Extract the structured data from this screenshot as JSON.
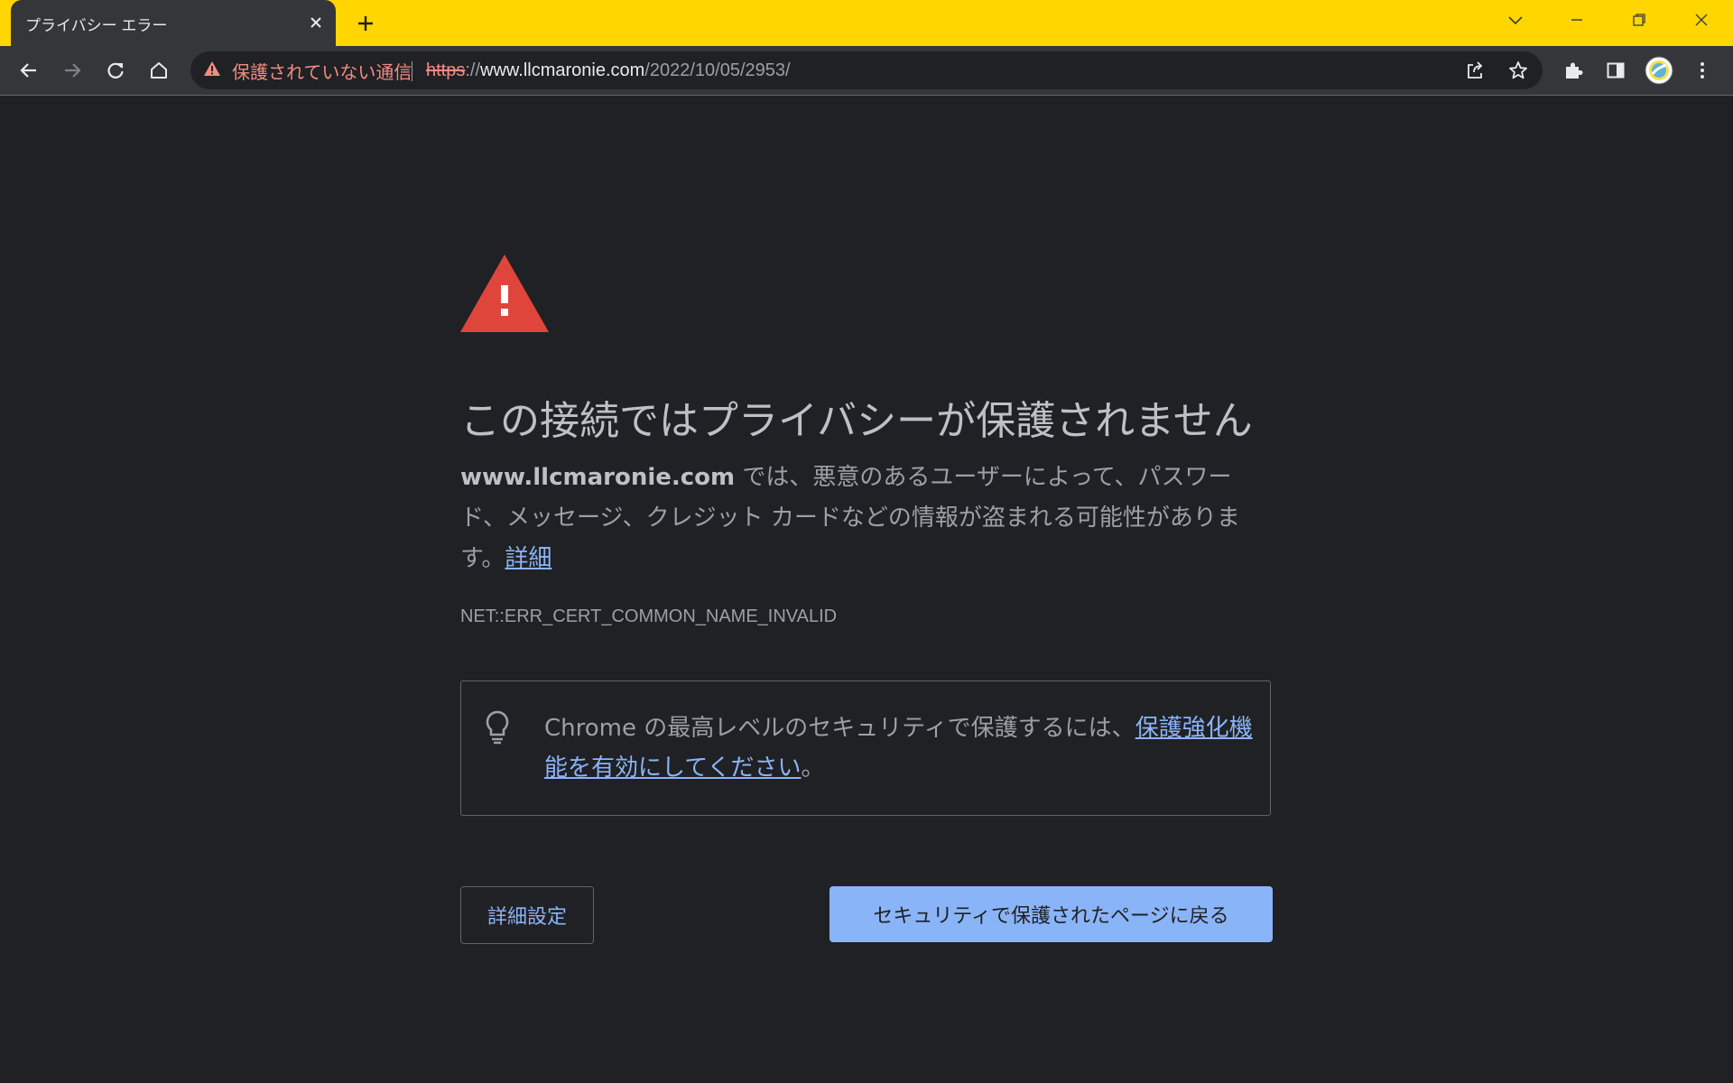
{
  "tab": {
    "title": "プライバシー エラー"
  },
  "colors": {
    "titlebar": "#ffd600",
    "link": "#8ab4f8",
    "warning_red": "#ea4335",
    "insecure_text": "#f28b82"
  },
  "omnibox": {
    "security_label": "保護されていない通信",
    "url_scheme": "https",
    "url_sep": "://",
    "url_host": "www.llcmaronie.com",
    "url_path": "/2022/10/05/2953/"
  },
  "content": {
    "heading": "この接続ではプライバシーが保護されません",
    "site": "www.llcmaronie.com",
    "explanation": " では、悪意のあるユーザーによって、パスワード、メッセージ、クレジット カードなどの情報が盗まれる可能性があります。",
    "details_link": "詳細",
    "error_code": "NET::ERR_CERT_COMMON_NAME_INVALID",
    "tip_text": "Chrome の最高レベルのセキュリティで保護するには、",
    "tip_link": "保護強化機能を有効にしてください",
    "tip_end": "。",
    "advanced_button": "詳細設定",
    "back_button": "セキュリティで保護されたページに戻る"
  },
  "icons": [
    "close-icon",
    "plus-icon",
    "chevron-down-icon",
    "minimize-icon",
    "restore-icon",
    "window-close-icon",
    "back-arrow-icon",
    "forward-arrow-icon",
    "reload-icon",
    "home-icon",
    "warning-icon",
    "share-icon",
    "star-icon",
    "puzzle-icon",
    "side-panel-icon",
    "avatar",
    "kebab-menu-icon",
    "lightbulb-icon"
  ]
}
